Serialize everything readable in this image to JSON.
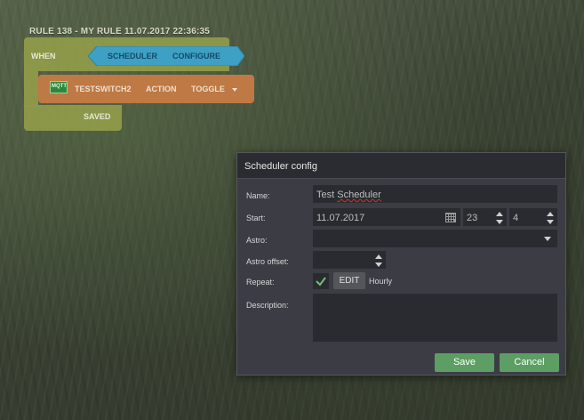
{
  "rule": {
    "title": "RULE 138 - MY RULE 11.07.2017 22:36:35",
    "when_label": "WHEN",
    "scheduler_label": "SCHEDULER",
    "configure_label": "CONFIGURE",
    "action_device": "TESTSWITCH2",
    "action_label": "ACTION",
    "toggle_label": "TOGGLE",
    "saved_label": "SAVED",
    "device_icon": "mqtt-monitor-icon",
    "device_icon_text": "MQTT"
  },
  "dialog": {
    "title": "Scheduler config",
    "fields": {
      "name_label": "Name:",
      "name_value": "Test Scheduler",
      "name_value_part1": "Test ",
      "name_value_part2": "Scheduler",
      "start_label": "Start:",
      "start_date": "11.07.2017",
      "start_hour": "23",
      "start_minute": "4",
      "astro_label": "Astro:",
      "astro_value": "",
      "astro_offset_label": "Astro offset:",
      "astro_offset_value": "",
      "repeat_label": "Repeat:",
      "repeat_edit": "EDIT",
      "repeat_value": "Hourly",
      "description_label": "Description:",
      "description_value": ""
    },
    "buttons": {
      "save": "Save",
      "cancel": "Cancel"
    }
  },
  "colors": {
    "block_green": "#8f9a4a",
    "block_orange": "#c57b45",
    "block_blue": "#3da4cc",
    "button_green": "#5c9e63",
    "dialog_bg": "#3c3d44"
  }
}
